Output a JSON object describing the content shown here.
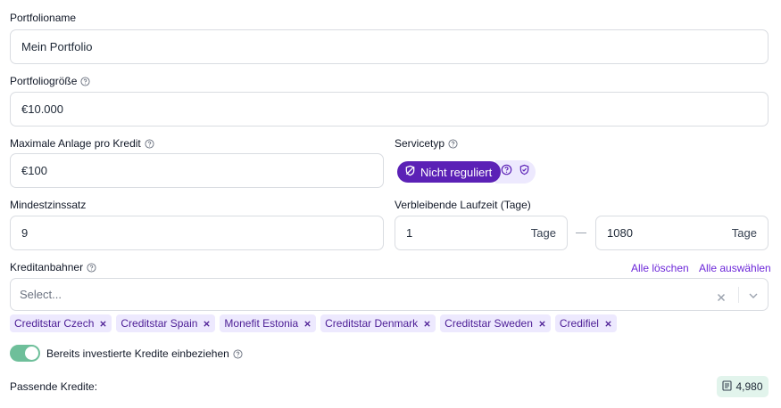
{
  "portfolio_name": {
    "label": "Portfolioname",
    "value": "Mein Portfolio"
  },
  "portfolio_size": {
    "label": "Portfoliogröße",
    "value": "€10.000"
  },
  "max_per_loan": {
    "label": "Maximale Anlage pro Kredit",
    "value": "€100"
  },
  "service_type": {
    "label": "Servicetyp",
    "selected": "Nicht reguliert"
  },
  "min_interest": {
    "label": "Mindestzinssatz",
    "value": "9"
  },
  "remaining_term": {
    "label": "Verbleibende Laufzeit (Tage)",
    "min": "1",
    "max": "1080",
    "unit": "Tage"
  },
  "originators": {
    "label": "Kreditanbahner",
    "clear_all": "Alle löschen",
    "select_all": "Alle auswählen",
    "placeholder": "Select...",
    "chips": [
      "Creditstar Czech",
      "Creditstar Spain",
      "Monefit Estonia",
      "Creditstar Denmark",
      "Creditstar Sweden",
      "Credifiel"
    ]
  },
  "include_invested": {
    "label": "Bereits investierte Kredite einbeziehen",
    "enabled": true
  },
  "matching": {
    "label": "Passende Kredite:",
    "count": "4,980"
  },
  "colors": {
    "accent": "#5b21b6",
    "chip_bg": "#ede9fe",
    "toggle_on": "#6ebf9a",
    "badge_bg": "#e2f4ec"
  }
}
